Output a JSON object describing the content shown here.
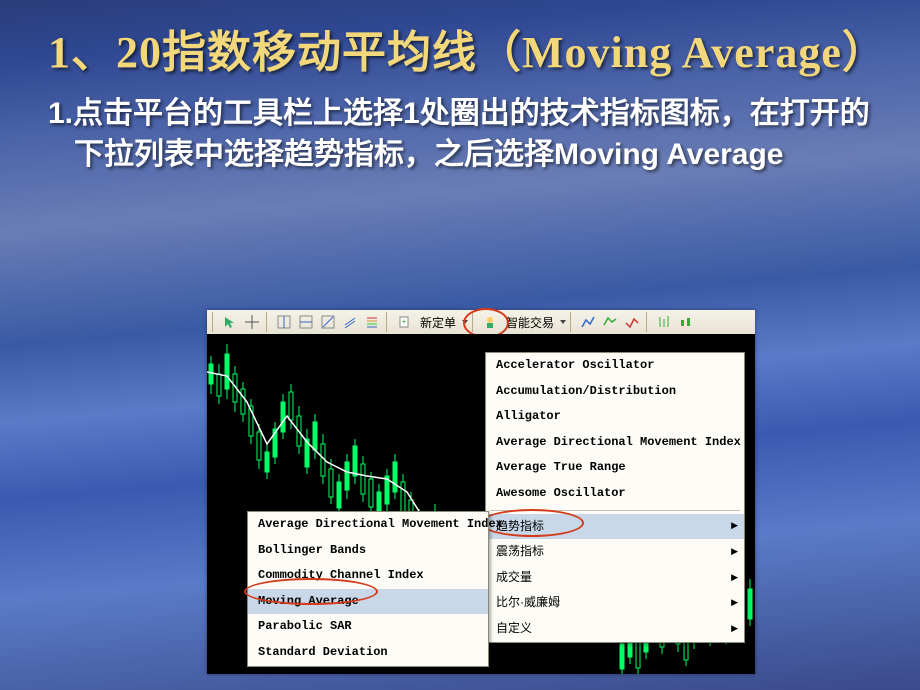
{
  "title": "1、20指数移动平均线（Moving Average）",
  "body": "1.点击平台的工具栏上选择1处圈出的技术指标图标，在打开的下拉列表中选择趋势指标，之后选择Moving Average",
  "toolbar": {
    "new_order": "新定单",
    "auto_trade": "智能交易"
  },
  "indicator_menu": {
    "items": [
      "Accelerator Oscillator",
      "Accumulation/Distribution",
      "Alligator",
      "Average Directional Movement Index",
      "Average True Range",
      "Awesome Oscillator"
    ],
    "categories": [
      "趋势指标",
      "震荡指标",
      "成交量",
      "比尔·威廉姆",
      "自定义"
    ]
  },
  "submenu": {
    "items": [
      "Average Directional Movement Index",
      "Bollinger Bands",
      "Commodity Channel Index",
      "Moving Average",
      "Parabolic SAR",
      "Standard Deviation"
    ],
    "highlighted_index": 3
  },
  "highlights": {
    "toolbar_icon_circle": true,
    "trend_indicator_circle": "趋势指标",
    "moving_average_circle": "Moving Average"
  }
}
